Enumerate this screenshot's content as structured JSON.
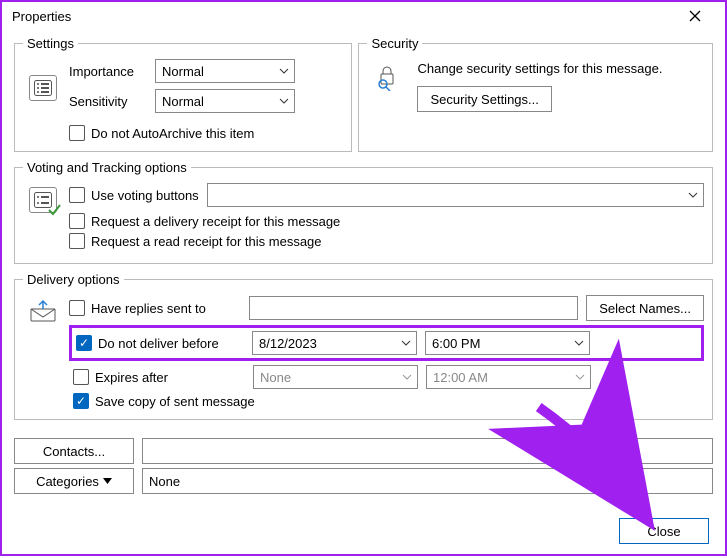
{
  "title": "Properties",
  "sections": {
    "settings": {
      "legend": "Settings",
      "importance_label": "Importance",
      "importance_value": "Normal",
      "sensitivity_label": "Sensitivity",
      "sensitivity_value": "Normal",
      "autoarchive_label": "Do not AutoArchive this item",
      "autoarchive_checked": false
    },
    "security": {
      "legend": "Security",
      "desc": "Change security settings for this message.",
      "button": "Security Settings..."
    },
    "voting": {
      "legend": "Voting and Tracking options",
      "use_voting_label": "Use voting buttons",
      "use_voting_checked": false,
      "delivery_receipt_label": "Request a delivery receipt for this message",
      "delivery_receipt_checked": false,
      "read_receipt_label": "Request a read receipt for this message",
      "read_receipt_checked": false
    },
    "delivery": {
      "legend": "Delivery options",
      "replies_label": "Have replies sent to",
      "replies_checked": false,
      "replies_value": "",
      "select_names": "Select Names...",
      "do_not_deliver_label": "Do not deliver before",
      "do_not_deliver_checked": true,
      "dnd_date": "8/12/2023",
      "dnd_time": "6:00 PM",
      "expires_label": "Expires after",
      "expires_checked": false,
      "expires_date": "None",
      "expires_time": "12:00 AM",
      "save_copy_label": "Save copy of sent message",
      "save_copy_checked": true
    }
  },
  "bottom": {
    "contacts_btn": "Contacts...",
    "contacts_value": "",
    "categories_btn": "Categories",
    "categories_value": "None"
  },
  "footer": {
    "close": "Close"
  }
}
